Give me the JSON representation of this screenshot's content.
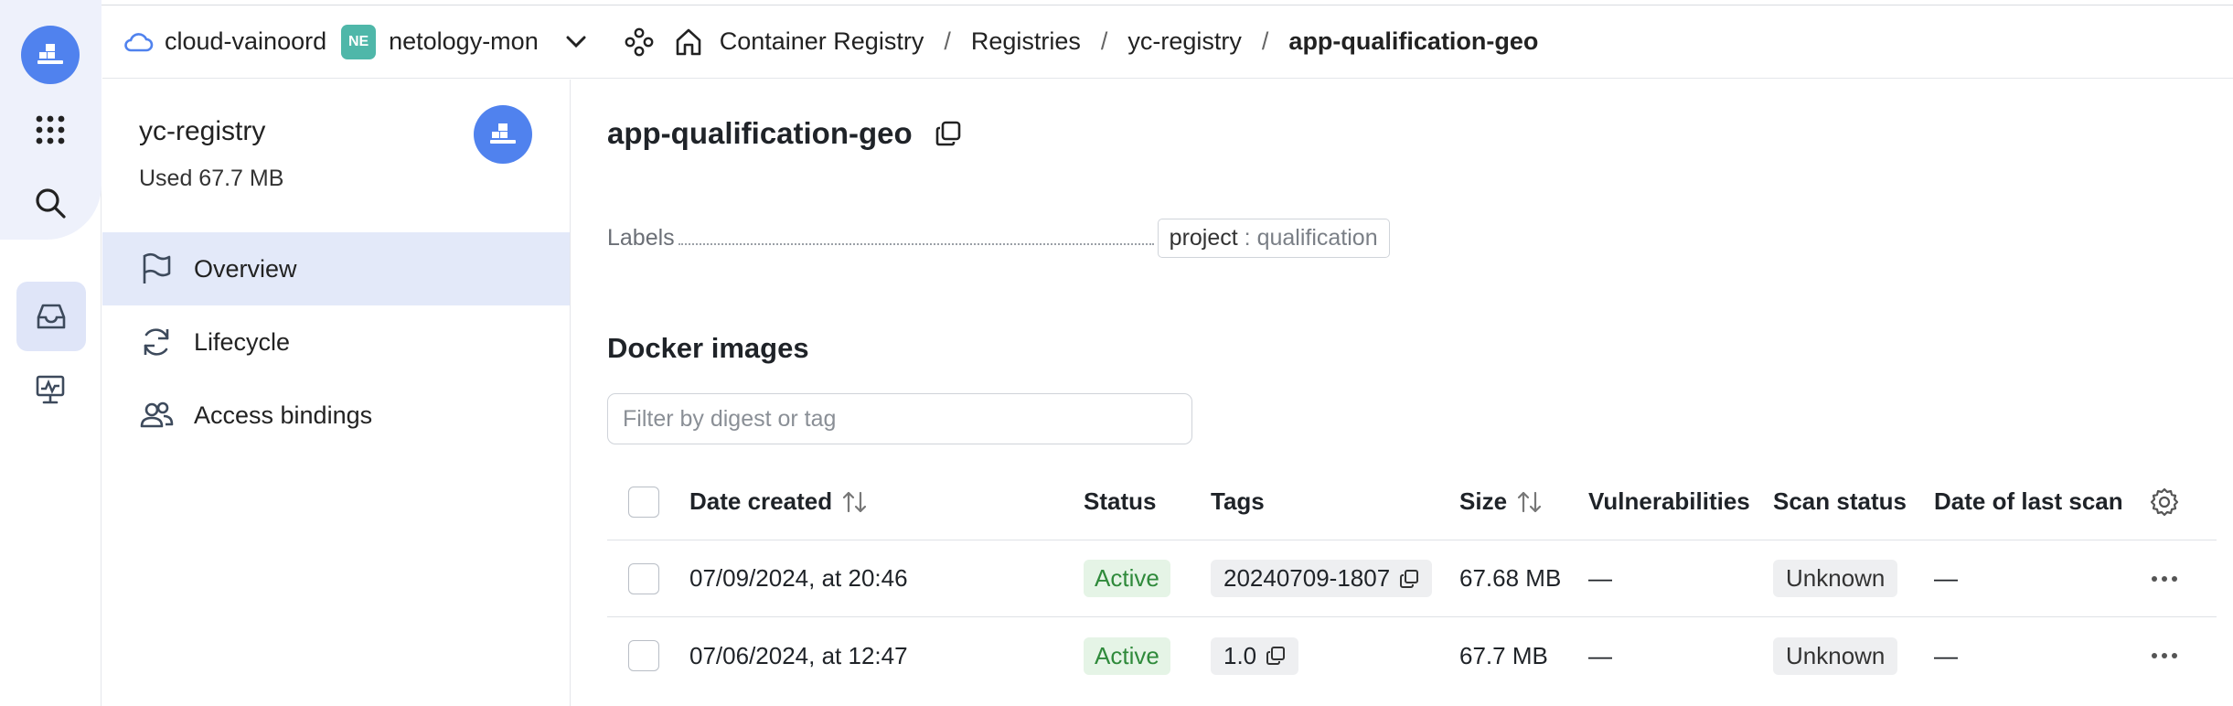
{
  "topbar": {
    "cloud_name": "cloud-vainoord",
    "folder_badge": "NE",
    "folder_name": "netology-mon",
    "breadcrumbs": [
      "Container Registry",
      "Registries",
      "yc-registry",
      "app-qualification-geo"
    ],
    "separator": "/"
  },
  "sidebar": {
    "registry_name": "yc-registry",
    "used": "Used 67.7 MB",
    "items": [
      {
        "label": "Overview",
        "icon": "flag-icon",
        "active": true
      },
      {
        "label": "Lifecycle",
        "icon": "refresh-icon",
        "active": false
      },
      {
        "label": "Access bindings",
        "icon": "users-icon",
        "active": false
      }
    ]
  },
  "main": {
    "title": "app-qualification-geo",
    "labels_caption": "Labels",
    "label_key": "project",
    "label_sep": ":",
    "label_value": "qualification",
    "section_title": "Docker images",
    "filter_placeholder": "Filter by digest or tag",
    "columns": {
      "date_created": "Date created",
      "status": "Status",
      "tags": "Tags",
      "size": "Size",
      "vulnerabilities": "Vulnerabilities",
      "scan_status": "Scan status",
      "date_last_scan": "Date of last scan"
    },
    "rows": [
      {
        "date": "07/09/2024, at 20:46",
        "status": "Active",
        "tag": "20240709-1807",
        "size": "67.68 MB",
        "vulnerabilities": "—",
        "scan_status": "Unknown",
        "last_scan": "—"
      },
      {
        "date": "07/06/2024, at 12:47",
        "status": "Active",
        "tag": "1.0",
        "size": "67.7 MB",
        "vulnerabilities": "—",
        "scan_status": "Unknown",
        "last_scan": "—"
      }
    ]
  },
  "colors": {
    "accent": "#5082ee",
    "status_active_bg": "#e5f4e6",
    "status_active_text": "#2f8a3b",
    "sidebar_active_bg": "#e3e9f9"
  }
}
